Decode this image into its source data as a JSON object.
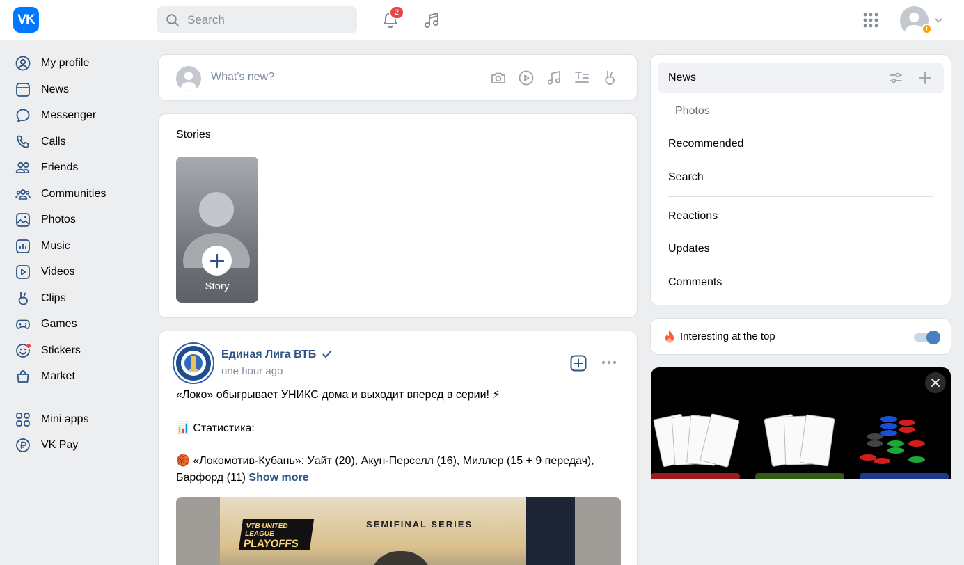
{
  "header": {
    "logo_text": "VK",
    "search_placeholder": "Search",
    "notification_count": "2"
  },
  "sidebar": {
    "items": [
      {
        "label": "My profile",
        "icon": "profile-icon"
      },
      {
        "label": "News",
        "icon": "news-icon"
      },
      {
        "label": "Messenger",
        "icon": "messenger-icon"
      },
      {
        "label": "Calls",
        "icon": "phone-icon"
      },
      {
        "label": "Friends",
        "icon": "friends-icon"
      },
      {
        "label": "Communities",
        "icon": "communities-icon"
      },
      {
        "label": "Photos",
        "icon": "photos-icon"
      },
      {
        "label": "Music",
        "icon": "music-icon"
      },
      {
        "label": "Videos",
        "icon": "videos-icon"
      },
      {
        "label": "Clips",
        "icon": "clips-icon"
      },
      {
        "label": "Games",
        "icon": "games-icon"
      },
      {
        "label": "Stickers",
        "icon": "stickers-icon"
      },
      {
        "label": "Market",
        "icon": "market-icon"
      }
    ],
    "extra": [
      {
        "label": "Mini apps",
        "icon": "mini-apps-icon"
      },
      {
        "label": "VK Pay",
        "icon": "vk-pay-icon"
      }
    ]
  },
  "composer": {
    "placeholder": "What's new?"
  },
  "stories": {
    "title": "Stories",
    "add_label": "Story"
  },
  "post": {
    "author": "Единая Лига ВТБ",
    "time": "one hour ago",
    "line1": "«Локо» обыгрывает УНИКС дома и выходит вперед в серии! ⚡",
    "line2": "📊 Статистика:",
    "line3": "🏀 «Локомотив-Кубань»: Уайт (20), Акун-Перселл (16), Миллер (15 + 9 передач),",
    "line4": "Барфорд (11)",
    "show_more": "Show more",
    "media_heading": "SEMIFINAL SERIES",
    "media_logo_line1": "VTB UNITED LEAGUE",
    "media_logo_line2": "PLAYOFFS"
  },
  "feed_filter": {
    "active": "News",
    "items": [
      "Photos",
      "Recommended",
      "Search"
    ],
    "items2": [
      "Reactions",
      "Updates",
      "Comments"
    ]
  },
  "interesting": {
    "label": "Interesting at the top",
    "enabled": true
  },
  "colors": {
    "accent": "#0077ff",
    "link": "#2c5485",
    "secondary_text": "#818c99",
    "background": "#edeef0",
    "badge": "#e64646"
  }
}
